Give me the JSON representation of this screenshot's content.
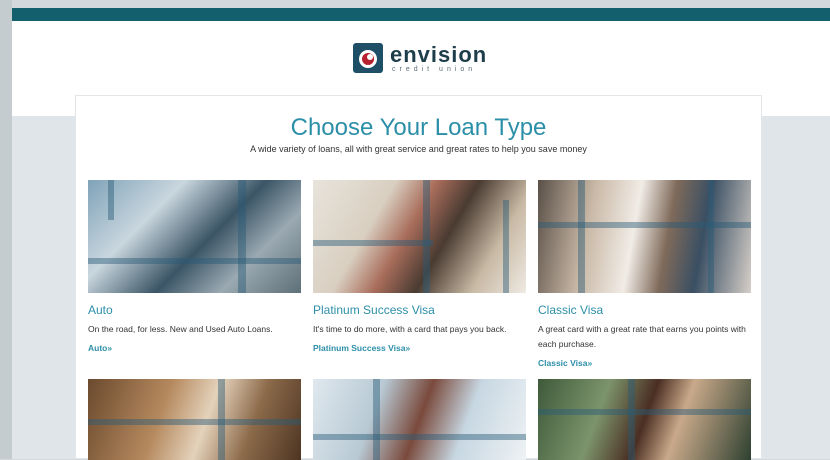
{
  "brand": {
    "name": "envision",
    "subtitle": "credit union"
  },
  "page": {
    "title": "Choose Your Loan Type",
    "subtitle": "A wide variety of loans, all with great service and great rates to help you save money"
  },
  "loans": [
    {
      "title": "Auto",
      "description": "On the road, for less. New and Used Auto Loans.",
      "link": "Auto"
    },
    {
      "title": "Platinum Success Visa",
      "description": "It's time to do more, with a card that pays you back.",
      "link": "Platinum Success Visa"
    },
    {
      "title": "Classic Visa",
      "description": "A great card with a great rate that earns you points with each purchase.",
      "link": "Classic Visa"
    }
  ],
  "link_suffix": "»",
  "colors": {
    "accent": "#2c8fa8",
    "header_bar": "#145f6e"
  }
}
